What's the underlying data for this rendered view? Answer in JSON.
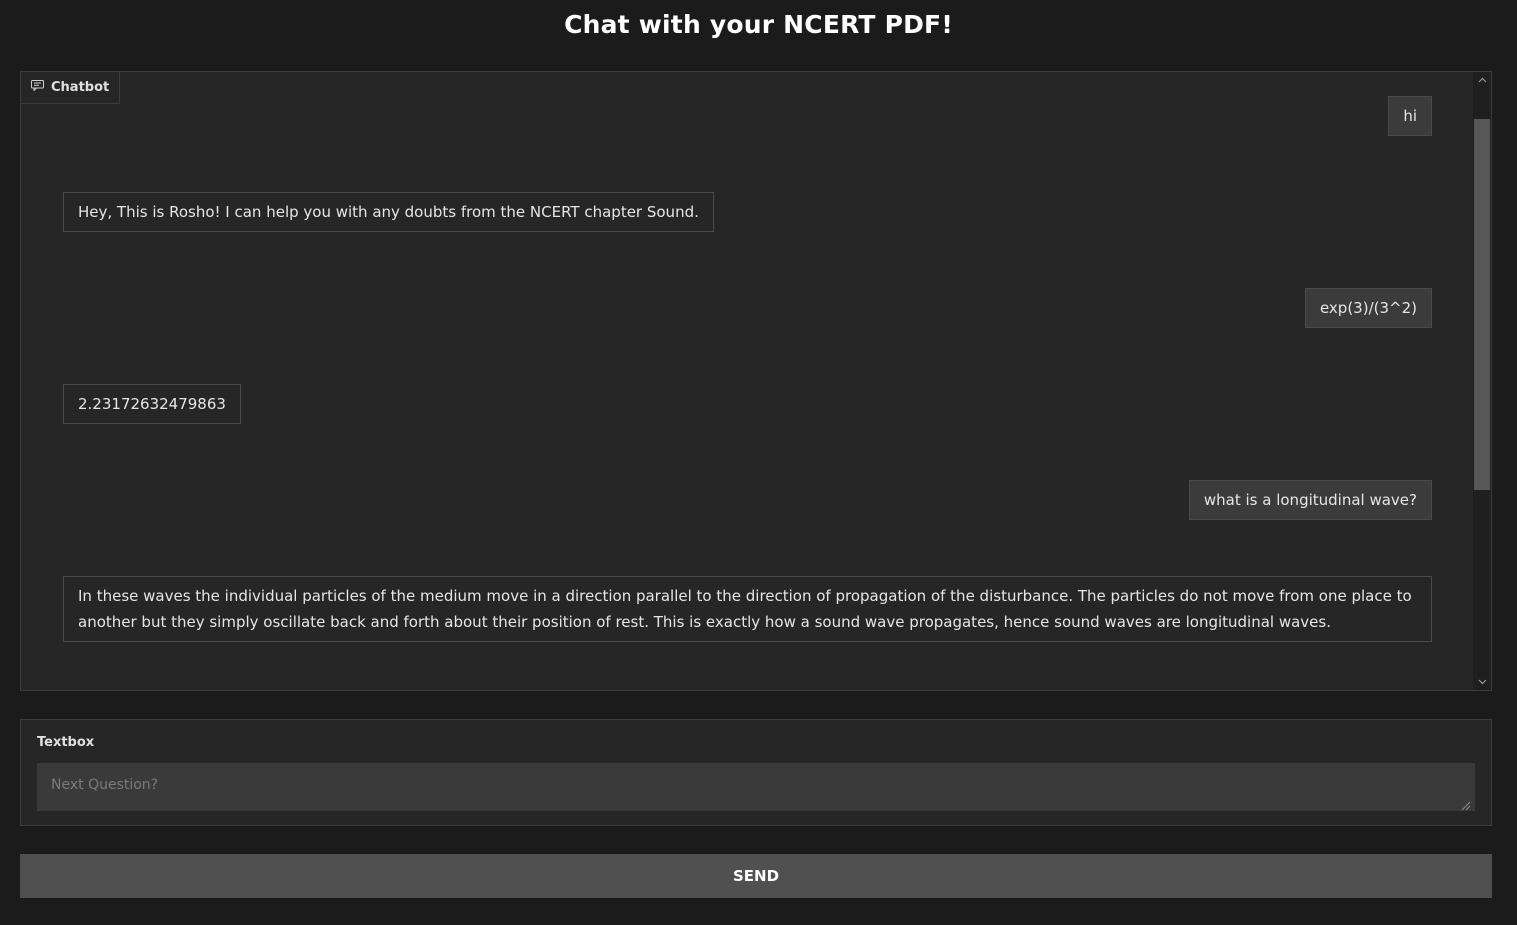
{
  "header": {
    "title": "Chat with your NCERT PDF!"
  },
  "chatbot": {
    "label": "Chatbot",
    "icon": "chat-bubble-icon",
    "messages": [
      {
        "role": "user",
        "text": "hi"
      },
      {
        "role": "bot",
        "text": "Hey, This is Rosho! I can help you with any doubts from the NCERT chapter Sound."
      },
      {
        "role": "user",
        "text": "exp(3)/(3^2)"
      },
      {
        "role": "bot",
        "text": "2.23172632479863"
      },
      {
        "role": "user",
        "text": "what is a longitudinal wave?"
      },
      {
        "role": "bot",
        "text": "In these waves the individual particles of the medium move in a direction parallel to the direction of propagation of the disturbance. The particles do not move from one place to another but they simply oscillate back and forth about their position of rest. This is exactly how a sound wave propagates, hence sound waves are longitudinal waves."
      }
    ]
  },
  "textbox": {
    "label": "Textbox",
    "placeholder": "Next Question?",
    "value": ""
  },
  "actions": {
    "send_label": "SEND"
  },
  "colors": {
    "background": "#1b1b1b",
    "panel": "#262626",
    "user_bubble": "#3b3b3b",
    "button": "#505050"
  }
}
